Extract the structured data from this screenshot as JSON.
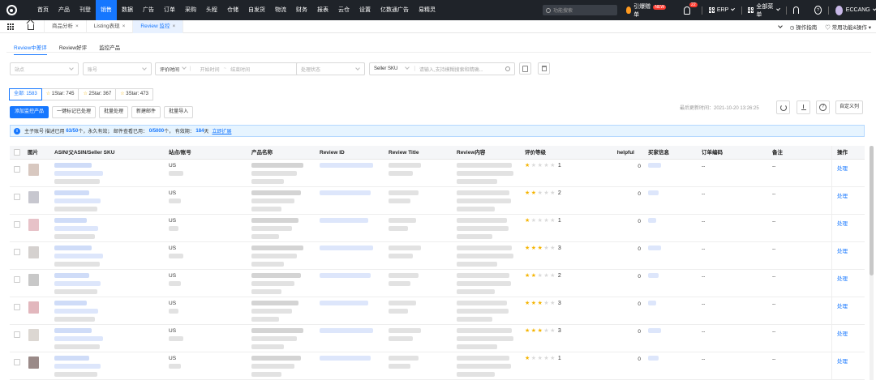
{
  "topnav": {
    "items": [
      "首页",
      "产品",
      "刊登",
      "销售",
      "数据",
      "广告",
      "订单",
      "采购",
      "头程",
      "仓储",
      "自发货",
      "物流",
      "财务",
      "报表",
      "云仓",
      "设置",
      "亿数通广告",
      "易精灵"
    ],
    "active": "销售",
    "search_placeholder": "功能搜索",
    "promo_label": "引爆赠单",
    "promo_badge": "NEW",
    "notification_count": "22",
    "erp_label": "ERP",
    "menu_label": "全部菜单",
    "user_name": "ECCANG"
  },
  "page_tabs": [
    {
      "label": "商品分析",
      "close": "×"
    },
    {
      "label": "Listing表现",
      "close": "×"
    },
    {
      "label": "Review 监控",
      "close": "×",
      "active": true
    }
  ],
  "tabbar_right": {
    "guide": "操作指南",
    "common": "常用功能&操作"
  },
  "subtabs": [
    "Review中差评",
    "Review好评",
    "监控产品"
  ],
  "filters": {
    "shop": "站点",
    "account": "账号",
    "date_type": "评价时间",
    "start": "开始时间",
    "end": "结束时间",
    "status": "处理状态",
    "sku_type": "Seller SKU",
    "search_placeholder": "请输入,支持模糊搜索和精确..."
  },
  "star_tabs": [
    {
      "label": "全部: 1583",
      "star": ""
    },
    {
      "label": "1Star: 745",
      "star": "☆"
    },
    {
      "label": "2Star: 367",
      "star": "☆"
    },
    {
      "label": "3Star: 473",
      "star": "☆"
    }
  ],
  "actions": [
    "添加监控产品",
    "一键标记已处理",
    "批量处理",
    "新建邮件",
    "批量导入"
  ],
  "updated_text": "最后更新时间：2021-10-20 13:26:25",
  "custom_columns": "自定义列",
  "banner": {
    "prefix": "主子账号 描述已用",
    "used1": "63/50",
    "mid1": "个，永久有效；  邮件查看已用：",
    "used2": "0/5000",
    "mid2": "个，  有效期：",
    "days": "184",
    "suffix": "天",
    "link": "立即扩展"
  },
  "table": {
    "columns": [
      "图片",
      "ASIN/父ASIN/Seller SKU",
      "站点/账号",
      "产品名称",
      "Review ID",
      "Review Title",
      "Review内容",
      "评价等级",
      "helpful",
      "买家信息",
      "订单编码",
      "备注",
      "操作"
    ],
    "rows": [
      {
        "site": "US",
        "rating": 1,
        "rating_text": "1",
        "helpful": "0",
        "order": "--",
        "note": "--",
        "action": "处理"
      },
      {
        "site": "US",
        "rating": 2,
        "rating_text": "2",
        "helpful": "0",
        "order": "--",
        "note": "--",
        "action": "处理"
      },
      {
        "site": "US",
        "rating": 1,
        "rating_text": "1",
        "helpful": "0",
        "order": "--",
        "note": "--",
        "action": "处理"
      },
      {
        "site": "US",
        "rating": 3,
        "rating_text": "3",
        "helpful": "0",
        "order": "--",
        "note": "--",
        "action": "处理"
      },
      {
        "site": "US",
        "rating": 2,
        "rating_text": "2",
        "helpful": "0",
        "order": "--",
        "note": "--",
        "action": "处理"
      },
      {
        "site": "US",
        "rating": 3,
        "rating_text": "3",
        "helpful": "0",
        "order": "--",
        "note": "--",
        "action": "处理"
      },
      {
        "site": "US",
        "rating": 3,
        "rating_text": "3",
        "helpful": "0",
        "order": "--",
        "note": "--",
        "action": "处理"
      },
      {
        "site": "US",
        "rating": 1,
        "rating_text": "1",
        "helpful": "0",
        "order": "--",
        "note": "--",
        "action": "处理"
      }
    ]
  },
  "colors": {
    "nav_bg": "#1f2329",
    "accent": "#1677ff",
    "star": "#f5b400"
  }
}
